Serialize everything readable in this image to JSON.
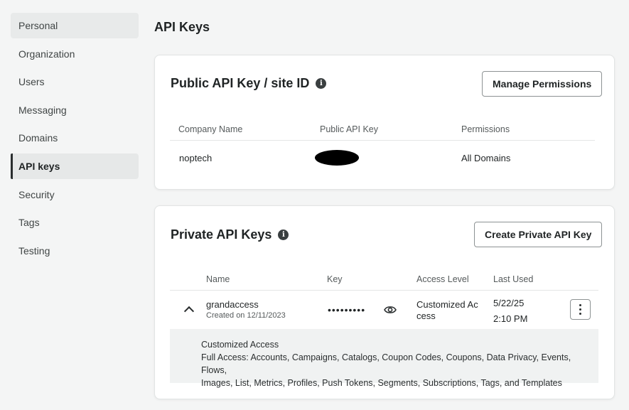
{
  "sidebar": {
    "items": [
      {
        "label": "Personal"
      },
      {
        "label": "Organization"
      },
      {
        "label": "Users"
      },
      {
        "label": "Messaging"
      },
      {
        "label": "Domains"
      },
      {
        "label": "API keys"
      },
      {
        "label": "Security"
      },
      {
        "label": "Tags"
      },
      {
        "label": "Testing"
      }
    ]
  },
  "page": {
    "title": "API Keys"
  },
  "public_card": {
    "title": "Public API Key / site ID",
    "button": "Manage Permissions",
    "columns": [
      "Company Name",
      "Public API Key",
      "Permissions"
    ],
    "row": {
      "company": "noptech",
      "permissions": "All Domains"
    }
  },
  "private_card": {
    "title": "Private API Keys",
    "button": "Create Private API Key",
    "columns": [
      "Name",
      "Key",
      "Access Level",
      "Last Used"
    ],
    "row": {
      "name": "grandaccess",
      "created": "Created on 12/11/2023",
      "key_masked": "•••••••••",
      "access_line1": "Customized Ac",
      "access_line2": "cess",
      "last_used_date": "5/22/25",
      "last_used_time": "2:10 PM"
    },
    "details": {
      "heading": "Customized Access",
      "line1": "Full Access: Accounts, Campaigns, Catalogs, Coupon Codes, Coupons, Data Privacy, Events, Flows,",
      "line2": "Images, List, Metrics, Profiles, Push Tokens, Segments, Subscriptions, Tags, and Templates"
    }
  },
  "icons": {
    "info": "info-icon",
    "chevron": "chevron-up-icon",
    "eye": "eye-icon",
    "menu": "kebab-menu-icon"
  }
}
